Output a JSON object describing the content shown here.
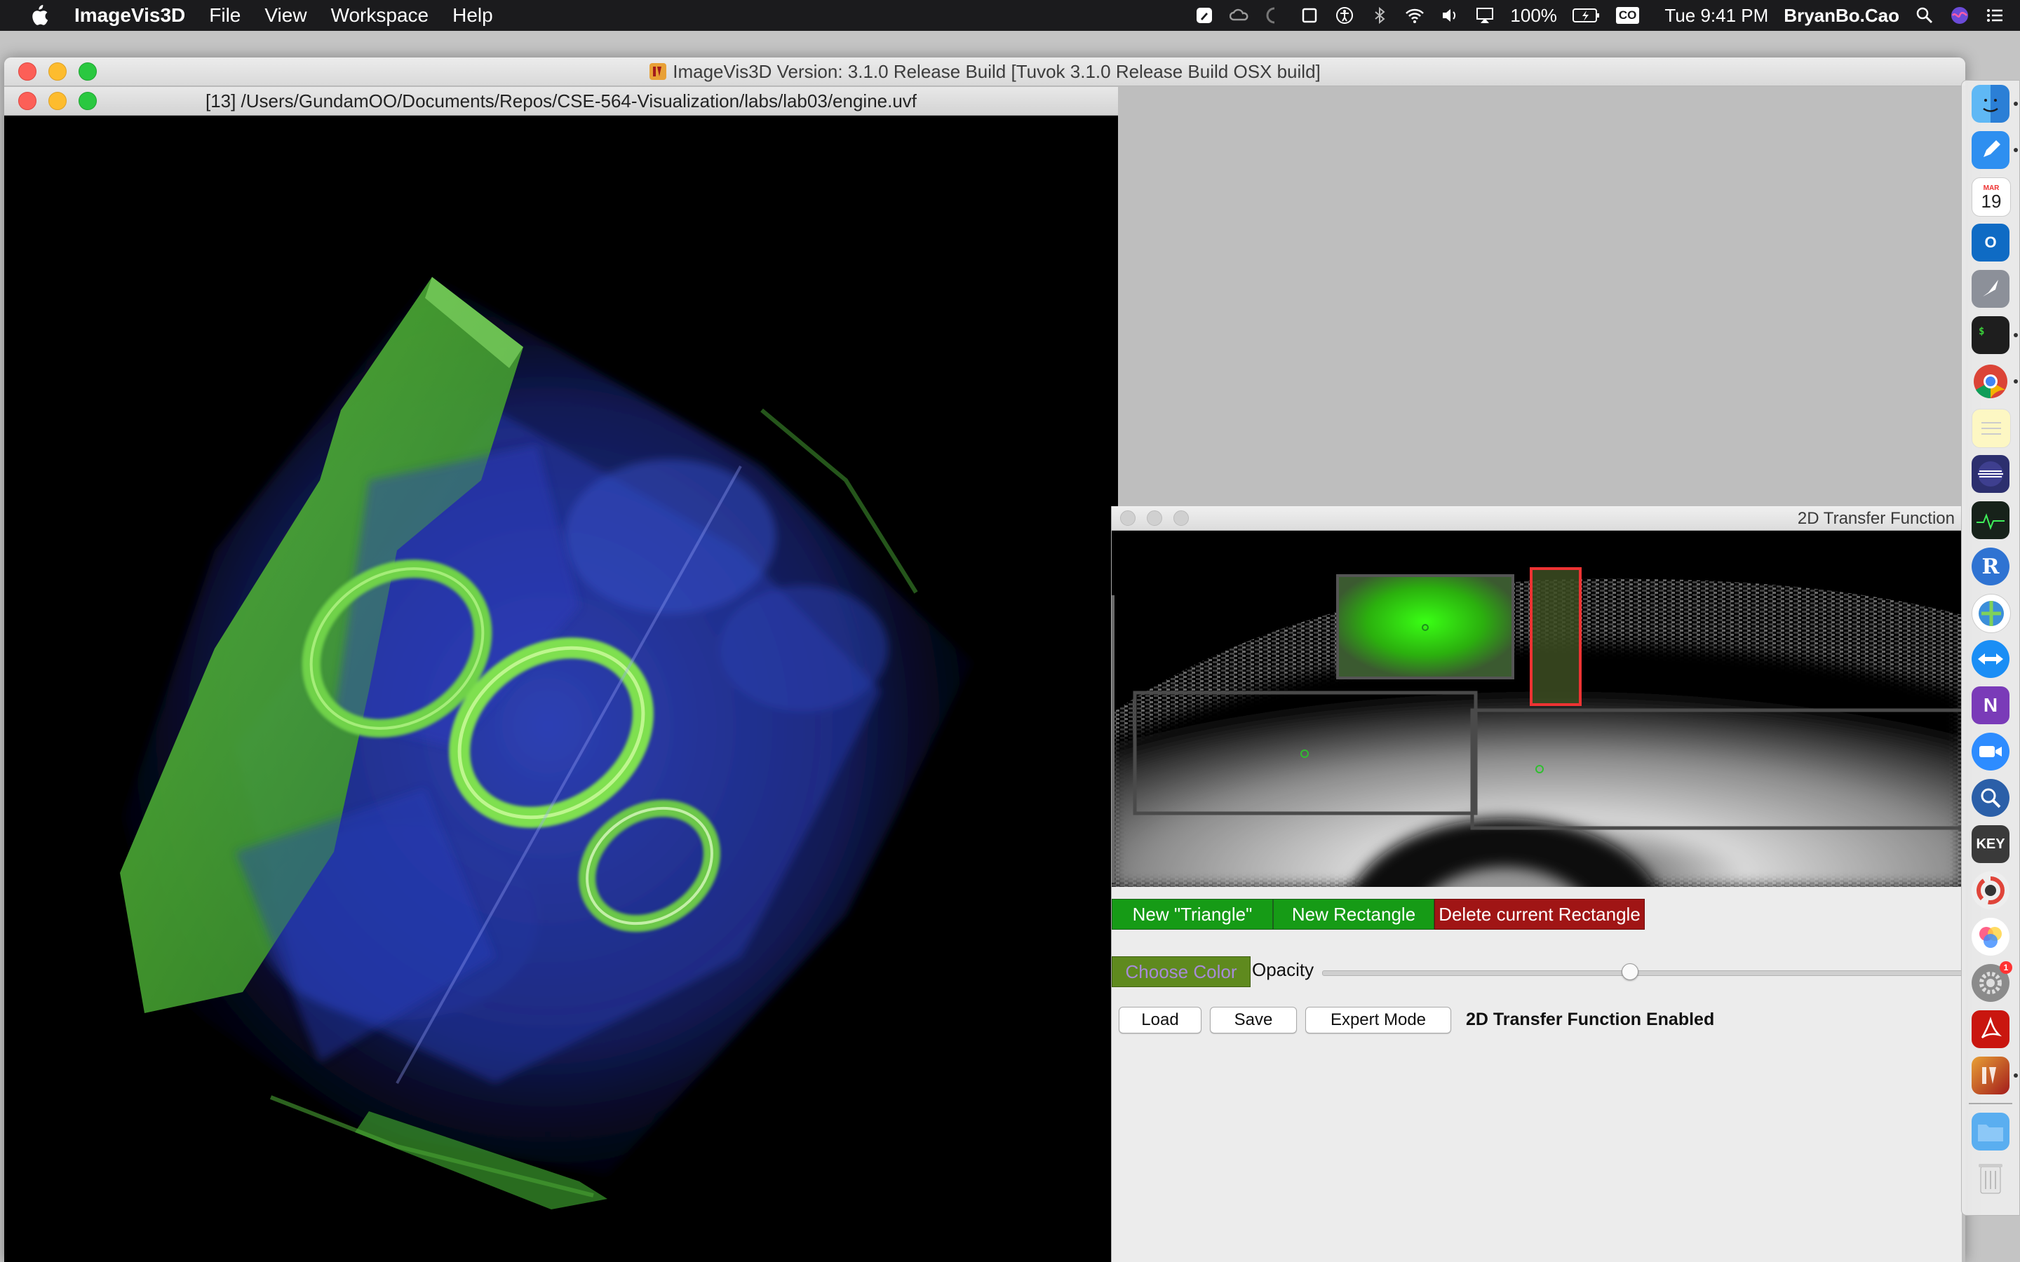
{
  "menubar": {
    "app_name": "ImageVis3D",
    "menus": [
      "File",
      "View",
      "Workspace",
      "Help"
    ],
    "battery": "100%",
    "input_badge": "CO",
    "clock": "Tue 9:41 PM",
    "user": "BryanBo.Cao"
  },
  "main_window": {
    "title": "ImageVis3D Version: 3.1.0 Release Build [Tuvok 3.1.0 Release Build OSX build]"
  },
  "render_window": {
    "title": "[13] /Users/GundamOO/Documents/Repos/CSE-564-Visualization/labs/lab03/engine.uvf"
  },
  "transfer_function": {
    "title": "2D Transfer Function",
    "new_triangle_label": "New \"Triangle\"",
    "new_rectangle_label": "New Rectangle",
    "delete_rectangle_label": "Delete current Rectangle",
    "choose_color_label": "Choose Color",
    "opacity_label": "Opacity",
    "opacity_value": 0.48,
    "load_label": "Load",
    "save_label": "Save",
    "expert_label": "Expert Mode",
    "status_text": "2D Transfer Function Enabled"
  },
  "dock": {
    "calendar_month": "MAR",
    "calendar_day": "19",
    "keynote_label": "KEY",
    "outlook_label": "O",
    "onenote_label": "N",
    "r_label": "R",
    "pref_badge": "1"
  },
  "colors": {
    "green_button": "#169b16",
    "red_button": "#a01515",
    "choose_color_bg": "#5f8a1e",
    "choose_color_text": "#a78bd8"
  }
}
